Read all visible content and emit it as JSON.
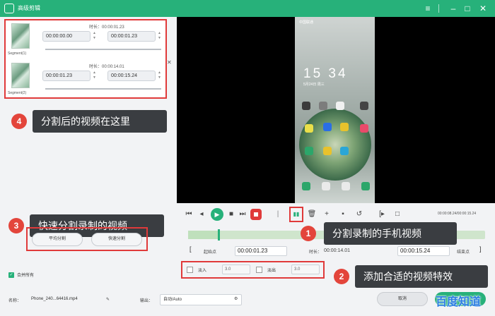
{
  "window": {
    "title": "高级剪辑"
  },
  "segments": [
    {
      "name": "Segment(1)",
      "duration_label": "时长：",
      "duration": "00:00:01.23",
      "start": "00:00:00.00",
      "end": "00:00:01.23"
    },
    {
      "name": "Segment(2)",
      "duration_label": "时长：",
      "duration": "00:00:14.01",
      "start": "00:00:01.23",
      "end": "00:00:15.24"
    }
  ],
  "callouts": {
    "c4": {
      "num": "4",
      "text": "分割后的视频在这里"
    },
    "c3": {
      "num": "3",
      "text": "快速分割录制的视频"
    },
    "c1": {
      "num": "1",
      "text": "分割录制的手机视频"
    },
    "c2": {
      "num": "2",
      "text": "添加合适的视频特效"
    }
  },
  "split_buttons": {
    "average": "平均分割",
    "quick": "快速分割"
  },
  "merge": {
    "label": "合并所有"
  },
  "phone": {
    "status": "中国联通",
    "clock": "15  34",
    "date": "5月24日 周三"
  },
  "player": {
    "time": "00:00:08.24/00:00:15.24"
  },
  "range": {
    "start_label": "起始点",
    "start_value": "00:00:01.23",
    "duration_label": "时长：",
    "duration_value": "00:00:14.01",
    "end_value": "00:00:15.24",
    "end_label": "结束点"
  },
  "effects": {
    "fade_in_label": "淡入",
    "fade_in_value": "3.0",
    "fade_out_label": "淡出",
    "fade_out_value": "3.0"
  },
  "footer": {
    "name_label": "名称：",
    "name_value": "Phone_240...64416.mp4",
    "output_label": "输出：",
    "output_value": "自动/Auto",
    "cancel": "取消",
    "ok": "确定"
  },
  "watermark": "百度知道",
  "colors": {
    "accent": "#27b17a",
    "highlight": "#e03a3a",
    "callout_bg": "#3a3d41"
  }
}
